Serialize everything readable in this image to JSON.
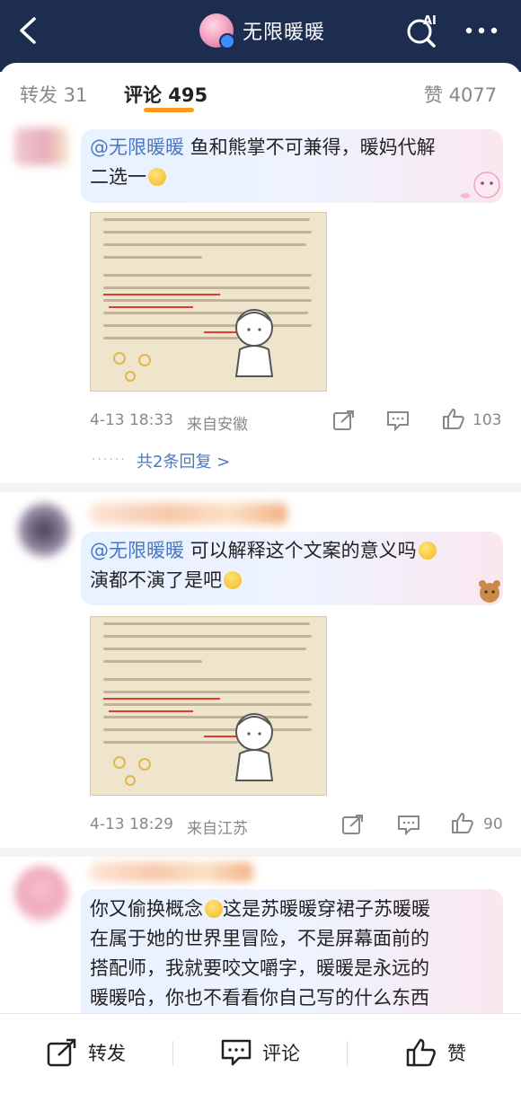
{
  "header": {
    "title": "无限暖暖",
    "ai_label": "AI"
  },
  "tabs": [
    {
      "label": "转发 31"
    },
    {
      "label": "评论 495"
    },
    {
      "label": "赞 4077"
    }
  ],
  "comments": [
    {
      "mention": "@无限暖暖",
      "text_line1": " 鱼和熊掌不可兼得，暖妈代解",
      "text_line2": "二选一",
      "image_text": [
        "版型也与常规大裙子不同—因为在聆听搭配师们的反馈后,",
        "发现大家穿着大裙子探索世界时,会受现实经验影响,有",
        "笨重、不舒适的主观感受。为了破除大裙子跑图的不良体",
        "验,我们选择了半透的纱质材料、露腿的版型设计,甚至在",
        "色块的分布上也别有讲究。希望能让搭配师们以轻盈利落",
        "的姿态在大世界里痛快地跑起来!"
      ],
      "time": "4-13 18:33",
      "source": "来自安徽",
      "likes": "103",
      "replies_link": "共2条回复 >"
    },
    {
      "mention": "@无限暖暖",
      "text_line1": " 可以解释这个文案的意义吗",
      "text_line2": "演都不演了是吧",
      "time": "4-13 18:29",
      "source": "来自江苏",
      "likes": "90"
    },
    {
      "line1": "你又偷换概念",
      "line1b": "这是苏暖暖穿裙子苏暖暖",
      "line2": "在属于她的世界里冒险，不是屏幕面前的",
      "line3": "搭配师，我就要咬文嚼字，暖暖是永远的",
      "line4": "暖暖哈，你也不看看你自己写的什么东西"
    }
  ],
  "bottom_bar": {
    "repost": "转发",
    "comment": "评论",
    "like": "赞"
  },
  "colors": {
    "header_bg": "#1c2d4f",
    "accent": "#ff9a1f",
    "link": "#4a78c2"
  }
}
